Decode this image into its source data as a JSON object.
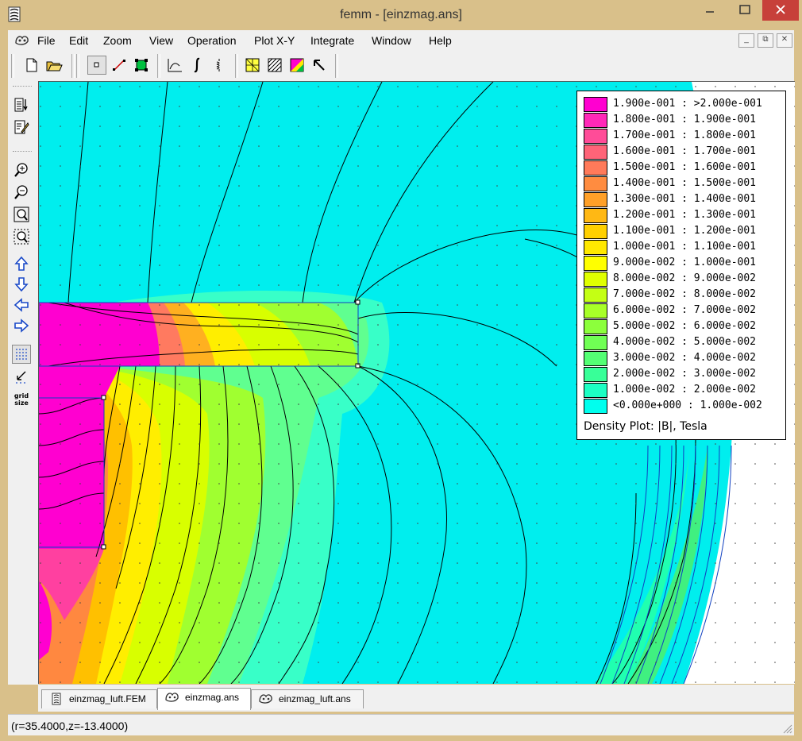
{
  "window": {
    "title": "femm - [einzmag.ans]"
  },
  "menu": [
    "File",
    "Edit",
    "Zoom",
    "View",
    "Operation",
    "Plot X-Y",
    "Integrate",
    "Window",
    "Help"
  ],
  "legend": {
    "rows": [
      {
        "label": "1.900e-001 : >2.000e-001",
        "color": "#ff00d0"
      },
      {
        "label": "1.800e-001 : 1.900e-001",
        "color": "#ff28b8"
      },
      {
        "label": "1.700e-001 : 1.800e-001",
        "color": "#ff4c98"
      },
      {
        "label": "1.600e-001 : 1.700e-001",
        "color": "#ff6478"
      },
      {
        "label": "1.500e-001 : 1.600e-001",
        "color": "#ff7a5a"
      },
      {
        "label": "1.400e-001 : 1.500e-001",
        "color": "#ff8c40"
      },
      {
        "label": "1.300e-001 : 1.400e-001",
        "color": "#ffa028"
      },
      {
        "label": "1.200e-001 : 1.300e-001",
        "color": "#ffb814"
      },
      {
        "label": "1.100e-001 : 1.200e-001",
        "color": "#ffd000"
      },
      {
        "label": "1.000e-001 : 1.100e-001",
        "color": "#ffe800"
      },
      {
        "label": "9.000e-002 : 1.000e-001",
        "color": "#ffff00"
      },
      {
        "label": "8.000e-002 : 9.000e-002",
        "color": "#e0ff00"
      },
      {
        "label": "7.000e-002 : 8.000e-002",
        "color": "#c4ff14"
      },
      {
        "label": "6.000e-002 : 7.000e-002",
        "color": "#a8ff28"
      },
      {
        "label": "5.000e-002 : 6.000e-002",
        "color": "#8cff3c"
      },
      {
        "label": "4.000e-002 : 5.000e-002",
        "color": "#70ff54"
      },
      {
        "label": "3.000e-002 : 4.000e-002",
        "color": "#54ff74"
      },
      {
        "label": "2.000e-002 : 3.000e-002",
        "color": "#38ff98"
      },
      {
        "label": "1.000e-002 : 2.000e-002",
        "color": "#1cffc4"
      },
      {
        "label": "<0.000e+000 : 1.000e-002",
        "color": "#00ffee"
      }
    ],
    "title": "Density Plot: |B|, Tesla"
  },
  "tabs": [
    {
      "label": "einzmag_luft.FEM",
      "icon": "femm-doc-icon"
    },
    {
      "label": "einzmag.ans",
      "icon": "femm-result-icon"
    },
    {
      "label": "einzmag_luft.ans",
      "icon": "femm-result-icon"
    }
  ],
  "status": {
    "coords": "(r=35.4000,z=-13.4000)"
  }
}
